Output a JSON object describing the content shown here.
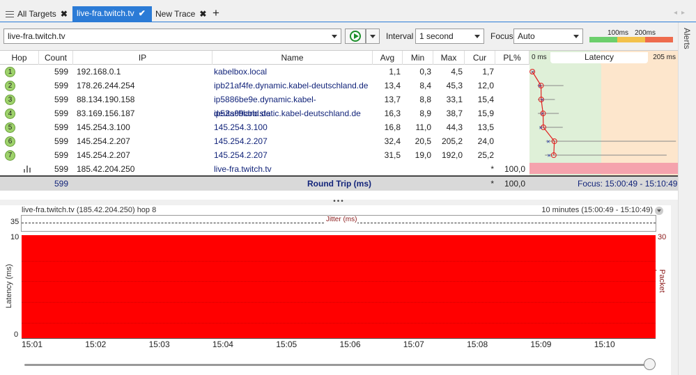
{
  "tabs": {
    "all_targets": "All Targets",
    "active": "live-fra.twitch.tv",
    "new_trace": "New Trace",
    "close_glyph": "✖",
    "check_glyph": "✔",
    "add_glyph": "+"
  },
  "side": {
    "alerts": "Alerts"
  },
  "toolbar": {
    "target": "live-fra.twitch.tv",
    "interval_label": "Interval",
    "interval_value": "1 second",
    "focus_label": "Focus",
    "focus_value": "Auto",
    "legend_100": "100ms",
    "legend_200": "200ms"
  },
  "colors": {
    "accent": "#2b7bd6",
    "good": "#6ccf6c",
    "warn": "#f3c14a",
    "bad": "#ee6b4d",
    "loss": "#ff0000"
  },
  "columns": {
    "hop": "Hop",
    "count": "Count",
    "ip": "IP",
    "name": "Name",
    "avg": "Avg",
    "min": "Min",
    "max": "Max",
    "cur": "Cur",
    "pl": "PL%",
    "latency": "Latency",
    "lat_min": "0 ms",
    "lat_max": "205 ms"
  },
  "hops": [
    {
      "hop": "1",
      "count": "599",
      "ip": "192.168.0.1",
      "name": "kabelbox.local",
      "avg": "1,1",
      "min": "0,3",
      "max": "4,5",
      "cur": "1,7",
      "pl": ""
    },
    {
      "hop": "2",
      "count": "599",
      "ip": "178.26.244.254",
      "name": "ipb21af4fe.dynamic.kabel-deutschland.de",
      "avg": "13,4",
      "min": "8,4",
      "max": "45,3",
      "cur": "12,0",
      "pl": ""
    },
    {
      "hop": "3",
      "count": "599",
      "ip": "88.134.190.158",
      "name": "ip5886be9e.dynamic.kabel-deutschland.de",
      "avg": "13,7",
      "min": "8,8",
      "max": "33,1",
      "cur": "15,4",
      "pl": ""
    },
    {
      "hop": "4",
      "count": "599",
      "ip": "83.169.156.187",
      "name": "ip53a99cbb.static.kabel-deutschland.de",
      "avg": "16,3",
      "min": "8,9",
      "max": "38,7",
      "cur": "15,9",
      "pl": ""
    },
    {
      "hop": "5",
      "count": "599",
      "ip": "145.254.3.100",
      "name": "145.254.3.100",
      "avg": "16,8",
      "min": "11,0",
      "max": "44,3",
      "cur": "13,5",
      "pl": ""
    },
    {
      "hop": "6",
      "count": "599",
      "ip": "145.254.2.207",
      "name": "145.254.2.207",
      "avg": "32,4",
      "min": "20,5",
      "max": "205,2",
      "cur": "24,0",
      "pl": ""
    },
    {
      "hop": "7",
      "count": "599",
      "ip": "145.254.2.207",
      "name": "145.254.2.207",
      "avg": "31,5",
      "min": "19,0",
      "max": "192,0",
      "cur": "25,2",
      "pl": ""
    },
    {
      "hop": "",
      "count": "599",
      "ip": "185.42.204.250",
      "name": "live-fra.twitch.tv",
      "avg": "",
      "min": "",
      "max": "",
      "cur": "*",
      "pl": "100,0"
    }
  ],
  "summary": {
    "count": "599",
    "label": "Round Trip (ms)",
    "cur": "*",
    "pl": "100,0",
    "focus": "Focus: 15:00:49 - 15:10:49"
  },
  "splitter": "•••",
  "graph": {
    "title": "live-fra.twitch.tv (185.42.204.250) hop 8",
    "range": "10 minutes (15:00:49 - 15:10:49)",
    "jitter_label": "Jitter (ms)",
    "jitter_max": "35",
    "y_max": "10",
    "y_min": "0",
    "y2_max": "30",
    "y_label": "Latency (ms)",
    "y2_label": "Packet Loss %",
    "x_ticks": [
      "15:01",
      "15:02",
      "15:03",
      "15:04",
      "15:05",
      "15:06",
      "15:07",
      "15:08",
      "15:09",
      "15:10"
    ]
  },
  "chart_data": {
    "type": "area",
    "x": [
      "15:01",
      "15:02",
      "15:03",
      "15:04",
      "15:05",
      "15:06",
      "15:07",
      "15:08",
      "15:09",
      "15:10"
    ],
    "series": [
      {
        "name": "Packet Loss %",
        "values": [
          100,
          100,
          100,
          100,
          100,
          100,
          100,
          100,
          100,
          100
        ]
      }
    ],
    "xlabel": "",
    "ylabel": "Latency (ms)",
    "ylim": [
      0,
      10
    ],
    "y2label": "Packet Loss %",
    "y2lim": [
      0,
      30
    ]
  }
}
